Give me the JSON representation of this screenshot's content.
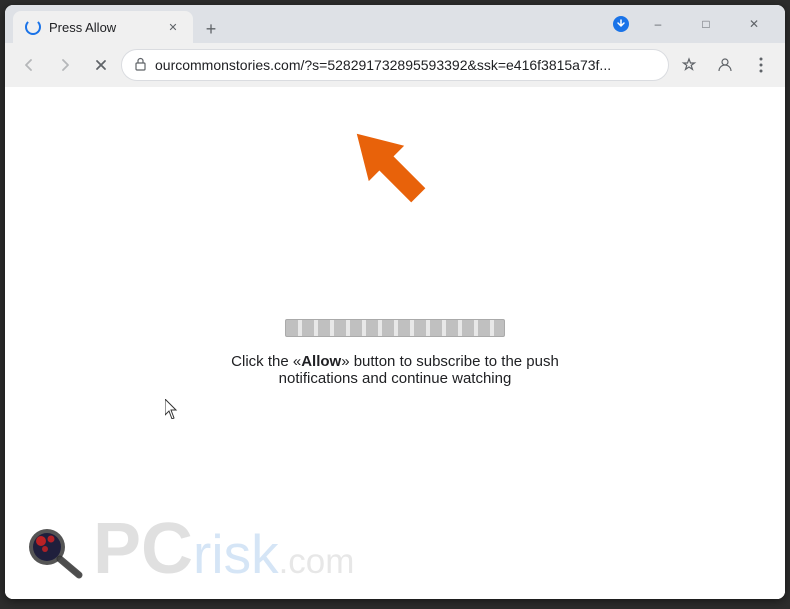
{
  "browser": {
    "tab": {
      "title": "Press Allow",
      "loading": true
    },
    "new_tab_label": "+",
    "window_controls": {
      "minimize": "–",
      "maximize": "□",
      "close": "✕"
    },
    "nav": {
      "back_label": "←",
      "forward_label": "→",
      "reload_label": "✕",
      "address": "ourcommonstories.com/?s=528291732895593392&ssk=e416f3815a73f...",
      "lock_icon": "🔒"
    },
    "toolbar_icons": {
      "download": "⬇",
      "star": "☆",
      "profile": "👤",
      "menu": "⋮"
    }
  },
  "page": {
    "subscription_text_before": "Click the «",
    "subscription_allow": "Allow",
    "subscription_text_after": "» button to subscribe to the push notifications and continue watching"
  },
  "logo": {
    "pc_text": "PC",
    "risk_text": "risk",
    "com_text": ".com"
  },
  "colors": {
    "orange_arrow": "#e8620a",
    "tab_bg": "#f0f0f0",
    "nav_bg": "#f0f0f0",
    "page_bg": "#ffffff",
    "progress_bg": "#c0c0c0",
    "logo_pc": "#9e9e9e",
    "logo_risk": "#4a90d9"
  }
}
